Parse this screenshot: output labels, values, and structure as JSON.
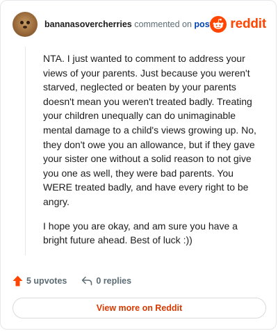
{
  "comment": {
    "username": "bananasovercherries",
    "action_text": "commented on",
    "post_link": "post",
    "paragraphs": [
      "NTA. I just wanted to comment to address your views of your parents. Just because you weren't starved, neglected or beaten by your parents doesn't mean you weren't treated badly. Treating your children unequally can do unimaginable mental damage to a child's views growing up. No, they don't owe you an allowance, but if they gave your sister one without a solid reason to not give you one as well, they were bad parents. You WERE treated badly, and have every right to be angry.",
      "I hope you are okay, and am sure you have a bright future ahead. Best of luck :))"
    ]
  },
  "brand": {
    "wordmark": "reddit",
    "accent_color": "#ff4500"
  },
  "actions": {
    "upvotes": "5 upvotes",
    "replies": "0 replies"
  },
  "footer": {
    "view_more": "View more on Reddit"
  },
  "icons": {
    "avatar": "cat-avatar-icon",
    "brand": "reddit-snoo-icon",
    "upvote": "upvote-arrow-icon",
    "reply": "reply-arrow-icon"
  }
}
